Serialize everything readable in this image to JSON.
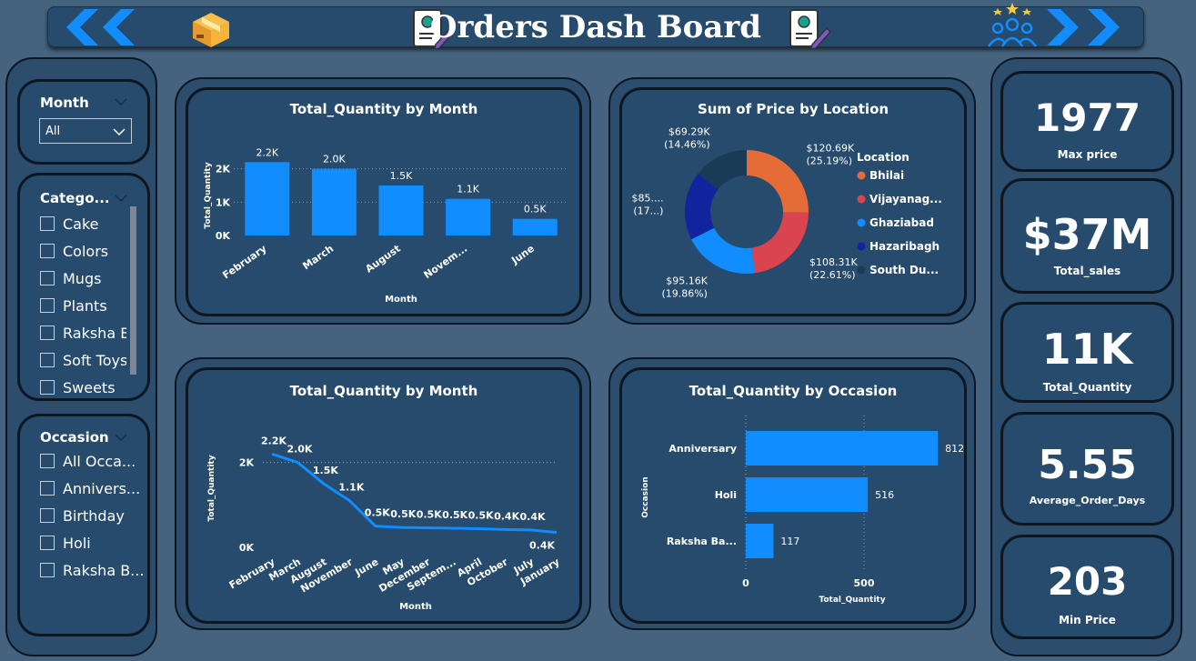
{
  "header": {
    "title": "Orders Dash Board"
  },
  "slicers": {
    "month": {
      "title": "Month",
      "selected": "All"
    },
    "category": {
      "title": "Catego...",
      "items": [
        "Cake",
        "Colors",
        "Mugs",
        "Plants",
        "Raksha B...",
        "Soft Toys",
        "Sweets"
      ]
    },
    "occasion": {
      "title": "Occasion",
      "items": [
        "All Occa...",
        "Annivers...",
        "Birthday",
        "Holi",
        "Raksha B..."
      ]
    }
  },
  "kpis": [
    {
      "value": "1977",
      "label": "Max price"
    },
    {
      "value": "$37M",
      "label": "Total_sales"
    },
    {
      "value": "11K",
      "label": "Total_Quantity"
    },
    {
      "value": "5.55",
      "label": "Average_Order_Days"
    },
    {
      "value": "203",
      "label": "Min Price"
    }
  ],
  "colors": {
    "bar": "#118dff",
    "text": "#ffffff"
  },
  "chart_data": [
    {
      "type": "bar",
      "title": "Total_Quantity by Month",
      "xlabel": "Month",
      "ylabel": "Total_Quantity",
      "categories": [
        "February",
        "March",
        "August",
        "Novem...",
        "June"
      ],
      "values": [
        2200,
        2000,
        1500,
        1100,
        500
      ],
      "data_labels": [
        "2.2K",
        "2.0K",
        "1.5K",
        "1.1K",
        "0.5K"
      ],
      "yticks": [
        "0K",
        "1K",
        "2K"
      ],
      "ylim": [
        0,
        2400
      ]
    },
    {
      "type": "pie",
      "title": "Sum of Price by Location",
      "legend_title": "Location",
      "legend": "right",
      "slices": [
        {
          "label": "Bhilai",
          "value": 120690,
          "text": "$120.69K",
          "pct": "(25.19%)",
          "color": "#e66c37"
        },
        {
          "label": "Vijayanag...",
          "value": 108310,
          "text": "$108.31K",
          "pct": "(22.61%)",
          "color": "#d9444f"
        },
        {
          "label": "Ghaziabad",
          "value": 95160,
          "text": "$95.16K",
          "pct": "(19.86%)",
          "color": "#118dff"
        },
        {
          "label": "Hazaribagh",
          "value": 85520,
          "text": "$85....",
          "pct": "(17...)",
          "color": "#12239e"
        },
        {
          "label": "South Du...",
          "value": 69290,
          "text": "$69.29K",
          "pct": "(14.46%)",
          "color": "#1a3b57"
        }
      ]
    },
    {
      "type": "line",
      "title": "Total_Quantity by Month",
      "xlabel": "Month",
      "ylabel": "Total_Quantity",
      "categories": [
        "February",
        "March",
        "August",
        "November",
        "June",
        "May",
        "December",
        "Septem...",
        "April",
        "October",
        "July",
        "January"
      ],
      "values": [
        2200,
        2000,
        1500,
        1100,
        500,
        470,
        460,
        450,
        440,
        420,
        410,
        350
      ],
      "data_labels": [
        "2.2K",
        "2.0K",
        "1.5K",
        "1.1K",
        "0.5K",
        "0.5K",
        "0.5K",
        "0.5K",
        "0.5K",
        "0.4K",
        "0.4K",
        "0.4K"
      ],
      "yticks": [
        "0K",
        "2K"
      ],
      "ylim": [
        0,
        2400
      ]
    },
    {
      "type": "bar",
      "orientation": "horizontal",
      "title": "Total_Quantity by Occasion",
      "xlabel": "Total_Quantity",
      "ylabel": "Occasion",
      "categories": [
        "Anniversary",
        "Holi",
        "Raksha Ba..."
      ],
      "values": [
        812,
        516,
        117
      ],
      "xticks": [
        "0",
        "500"
      ],
      "xlim": [
        0,
        900
      ]
    }
  ]
}
